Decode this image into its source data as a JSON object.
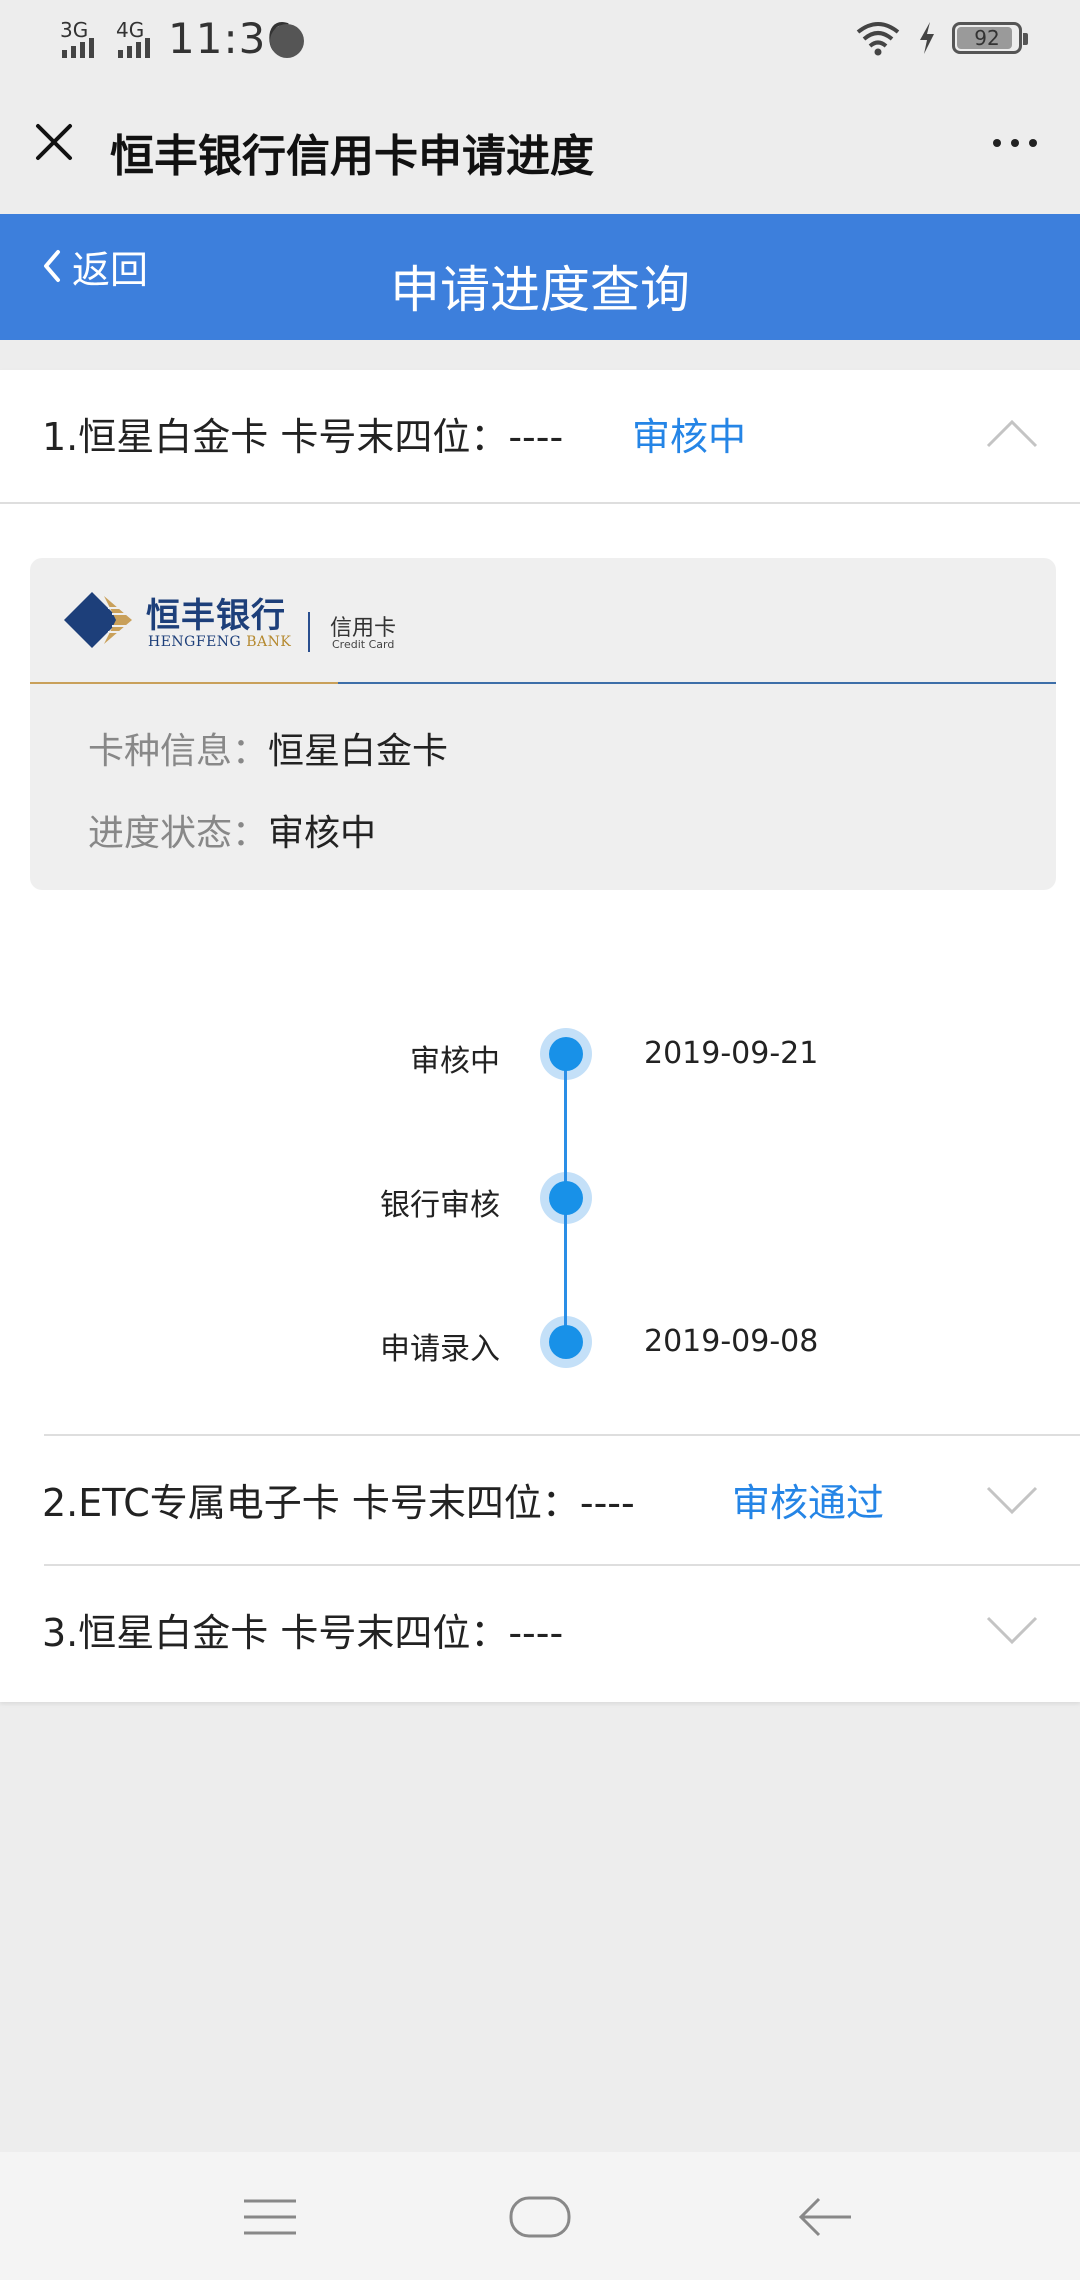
{
  "status_bar": {
    "network_1": "3G",
    "network_2": "4G",
    "time": "11:36",
    "battery": "92",
    "battery_level_percent": 92
  },
  "title_bar": {
    "title": "恒丰银行信用卡申请进度",
    "close_icon": "close-icon",
    "more_icon": "more-icon"
  },
  "header": {
    "back_label": "返回",
    "title": "申请进度查询"
  },
  "applications": [
    {
      "text": "1.恒星白金卡 卡号末四位：----",
      "status": "审核中",
      "expanded": true
    },
    {
      "text": "2.ETC专属电子卡 卡号末四位：----",
      "status": "审核通过",
      "expanded": false
    },
    {
      "text": "3.恒星白金卡 卡号末四位：----",
      "status": "",
      "expanded": false
    }
  ],
  "card": {
    "bank_name": "恒丰银行",
    "bank_en": "HENGFENG",
    "bank_en_2": "BANK",
    "credit_card": "信用卡",
    "credit_card_en": "Credit Card",
    "card_type_label": "卡种信息：",
    "card_type_value": "恒星白金卡",
    "progress_label": "进度状态：",
    "progress_value": "审核中"
  },
  "timeline": [
    {
      "label": "审核中",
      "date": "2019-09-21"
    },
    {
      "label": "银行审核",
      "date": ""
    },
    {
      "label": "申请录入",
      "date": "2019-09-08"
    }
  ],
  "colors": {
    "header_bg": "#3d7fdc",
    "status_blue": "#2585e6",
    "timeline_blue": "#1891e8"
  }
}
